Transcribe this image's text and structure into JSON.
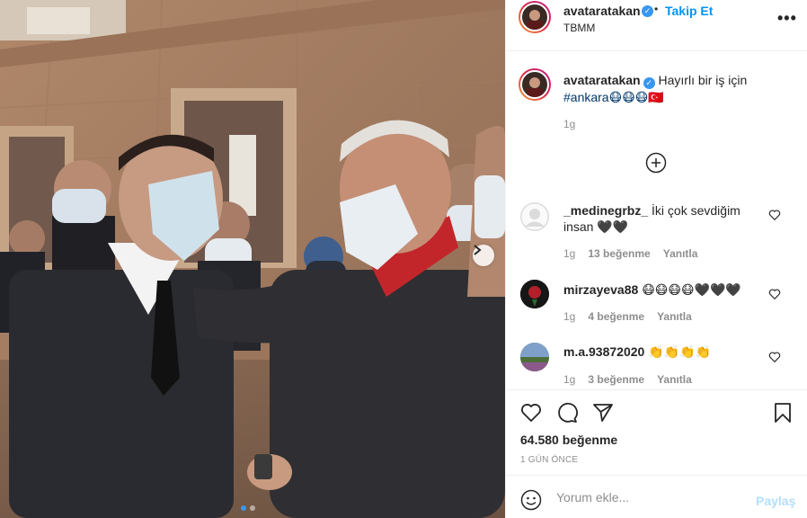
{
  "header": {
    "username": "avataratakan",
    "separator": "•",
    "follow_label": "Takip Et",
    "location": "TBMM",
    "more_label": "•••"
  },
  "caption": {
    "username": "avataratakan",
    "text": "Hayırlı bir iş için",
    "hashtag": "#ankara😷😷😷🇹🇷",
    "time": "1g"
  },
  "comments": [
    {
      "username": "_medinegrbz_",
      "text": "İki çok sevdiğim insan 🖤🖤",
      "time": "1g",
      "likes": "13 beğenme",
      "reply": "Yanıtla"
    },
    {
      "username": "mirzayeva88",
      "text": "😷😷😷😷🖤🖤🖤",
      "time": "1g",
      "likes": "4 beğenme",
      "reply": "Yanıtla"
    },
    {
      "username": "m.a.93872020",
      "text": "👏👏👏👏",
      "time": "1g",
      "likes": "3 beğenme",
      "reply": "Yanıtla"
    }
  ],
  "actions": {
    "likes": "64.580 beğenme",
    "date": "1 GÜN ÖNCE"
  },
  "footer": {
    "placeholder": "Yorum ekle...",
    "post_label": "Paylaş"
  },
  "carousel": {
    "total_slides": 2,
    "active_slide": 1
  },
  "colors": {
    "accent": "#0095f6",
    "muted": "#8e8e8e",
    "border": "#efefef",
    "post_disabled": "#b2dffc"
  }
}
